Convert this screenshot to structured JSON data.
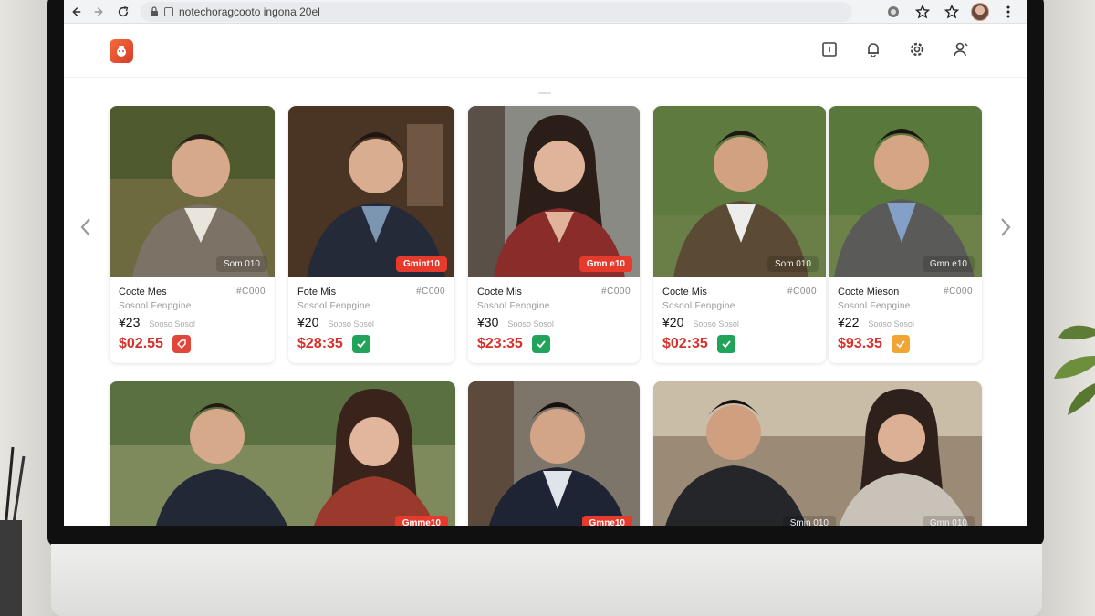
{
  "browser": {
    "url": "notechoragcooto ingona 20el",
    "back_icon": "arrow-left-icon",
    "forward_icon": "arrow-right-icon",
    "reload_icon": "reload-icon"
  },
  "header": {
    "logo_icon": "app-logo-icon",
    "actions": [
      "tablet-icon",
      "bell-icon",
      "settings-icon",
      "user-icon"
    ]
  },
  "cards": [
    {
      "name": "Cocte Mes",
      "code": "#C000",
      "sub": "Sosool Fenpgine",
      "price": "¥23",
      "note": "Sooso Sosol",
      "sale": "$02.55",
      "tag": "Som 010",
      "status": "red"
    },
    {
      "name": "Fote Mis",
      "code": "#C000",
      "sub": "Sosool Fenpgine",
      "price": "¥20",
      "note": "Sooso Sosol",
      "sale": "$28:35",
      "tag": "Gmint10",
      "status": "green"
    },
    {
      "name": "Cocte Mis",
      "code": "#C000",
      "sub": "Sosool Fenpgine",
      "price": "¥30",
      "note": "Sooso Sosol",
      "sale": "$23:35",
      "tag": "Gmn e10",
      "status": "green"
    },
    {
      "name": "Cocte Mis",
      "code": "#C000",
      "sub": "Sosool Fenpgine",
      "price": "¥20",
      "note": "Sooso Sosol",
      "sale": "$02:35",
      "tag": "Som 010",
      "status": "green"
    },
    {
      "name": "Cocte Mieson",
      "code": "#C000",
      "sub": "Sosool Fenpgine",
      "price": "¥22",
      "note": "Sooso Sosol",
      "sale": "$93.35",
      "tag": "Gmn e10",
      "status": "orange"
    },
    {
      "tag": "Gmme10"
    },
    {
      "tag": "Gmne10"
    },
    {
      "tag": "Smin 010"
    },
    {
      "tag": "Gmn 010"
    }
  ],
  "colors": {
    "accent_red": "#e53a2c",
    "ok_green": "#22a35a",
    "warn_orange": "#f0a534"
  }
}
